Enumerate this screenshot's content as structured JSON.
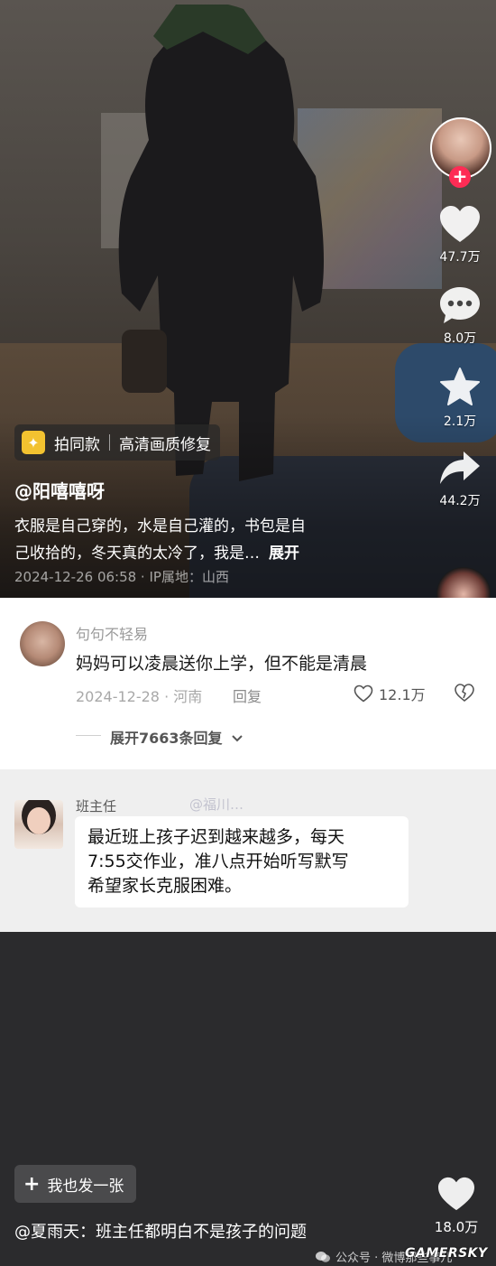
{
  "video": {
    "tags": {
      "same_style": "拍同款",
      "hd_repair": "高清画质修复"
    },
    "author": "@阳嘻嘻呀",
    "caption_line1": "衣服是自己穿的，水是自己灌的，书包是自",
    "caption_line2": "己收拾的，冬天真的太冷了，我是…",
    "expand": "展开",
    "meta": "2024-12-26 06:58 · IP属地：山西",
    "side": {
      "like_count": "47.7万",
      "comment_count": "8.0万",
      "favorite_count": "2.1万",
      "share_count": "44.2万"
    }
  },
  "comment1": {
    "user": "句句不轻易",
    "text": "妈妈可以凌晨送你上学，但不能是清晨",
    "meta": "2024-12-28 · 河南",
    "reply": "回复",
    "like_count": "12.1万",
    "more_replies": "展开7663条回复"
  },
  "comment2": {
    "user": "班主任",
    "mention": "@福川…",
    "line1": "最近班上孩子迟到越来越多，每天",
    "line2": "7:55交作业，准八点开始听写默写",
    "line3": "希望家长克服困难。"
  },
  "bottom": {
    "post_button": "我也发一张",
    "caption": "@夏雨天：班主任都明白不是孩子的问题",
    "like_count": "18.0万",
    "watermark_wechat": "公众号 · 微博那些事儿",
    "watermark_gamersky": "GAMERSKY"
  },
  "colors": {
    "follow": "#fe2c55",
    "tag_icon": "#f2c230"
  }
}
